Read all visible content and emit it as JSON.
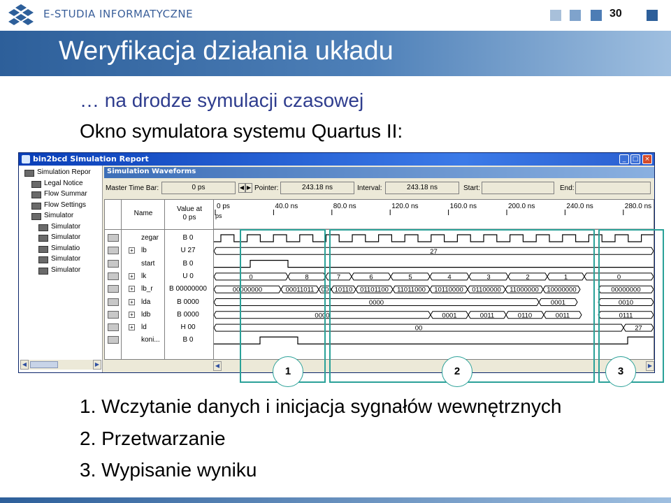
{
  "header": {
    "brand": "E-STUDIA INFORMATYCZNE",
    "page_number": "30",
    "square_colors": [
      "#a8c0da",
      "#7fa3cc",
      "#4d7db5",
      "#2d5f9a"
    ]
  },
  "slide": {
    "title": "Weryfikacja działania układu",
    "subtitle": "… na drodze symulacji czasowej",
    "subtitle2": "Okno symulatora systemu Quartus II:",
    "items": [
      "1. Wczytanie danych i inicjacja sygnałów wewnętrznych",
      "2. Przetwarzanie",
      "3. Wypisanie wyniku"
    ]
  },
  "window": {
    "title": "bin2bcd Simulation Report",
    "tree": [
      "Simulation Repor",
      "Legal Notice",
      "Flow Summar",
      "Flow Settings",
      "Simulator",
      "Simulator",
      "Simulator",
      "Simulatio",
      "Simulator",
      "Simulator"
    ],
    "pane_title": "Simulation Waveforms",
    "toolbar": {
      "master_label": "Master Time Bar:",
      "master_value": "0 ps",
      "pointer_label": "Pointer:",
      "pointer_value": "243.18 ns",
      "interval_label": "Interval:",
      "interval_value": "243.18 ns",
      "start_label": "Start:",
      "start_value": "",
      "end_label": "End:",
      "end_value": ""
    },
    "columns": {
      "name": "Name",
      "value": "Value at\n0 ps"
    },
    "time_labels": [
      "0 ps",
      "40.0 ns",
      "80.0 ns",
      "120.0 ns",
      "160.0 ns",
      "200.0 ns",
      "240.0 ns",
      "280.0 ns"
    ],
    "time_origin_label": "ps",
    "signals": [
      {
        "name": "zegar",
        "value": "B 0",
        "expand": false
      },
      {
        "name": "lb",
        "value": "U 27",
        "expand": true
      },
      {
        "name": "start",
        "value": "B 0",
        "expand": false
      },
      {
        "name": "lk",
        "value": "U 0",
        "expand": true
      },
      {
        "name": "lb_r",
        "value": "B 00000000",
        "expand": true
      },
      {
        "name": "lda",
        "value": "B 0000",
        "expand": true
      },
      {
        "name": "ldb",
        "value": "B 0000",
        "expand": true
      },
      {
        "name": "ld",
        "value": "H 00",
        "expand": true
      },
      {
        "name": "koni...",
        "value": "B 0",
        "expand": false
      }
    ],
    "bus_labels": {
      "lb": [
        "27"
      ],
      "lk": [
        "0",
        "8",
        "7",
        "6",
        "5",
        "4",
        "3",
        "2",
        "1",
        "0"
      ],
      "lb_r": [
        "00000000",
        "00011011",
        "00",
        "10110",
        "01101100",
        "11011000",
        "10110000",
        "01100000",
        "11000000",
        "10000000",
        "00000000"
      ],
      "lda": [
        "0000",
        "0001",
        "0010"
      ],
      "ldb": [
        "0000",
        "0001",
        "0011",
        "0110",
        "0011",
        "0111"
      ],
      "ld": [
        "00",
        "27"
      ]
    }
  },
  "regions": [
    "1",
    "2",
    "3"
  ]
}
